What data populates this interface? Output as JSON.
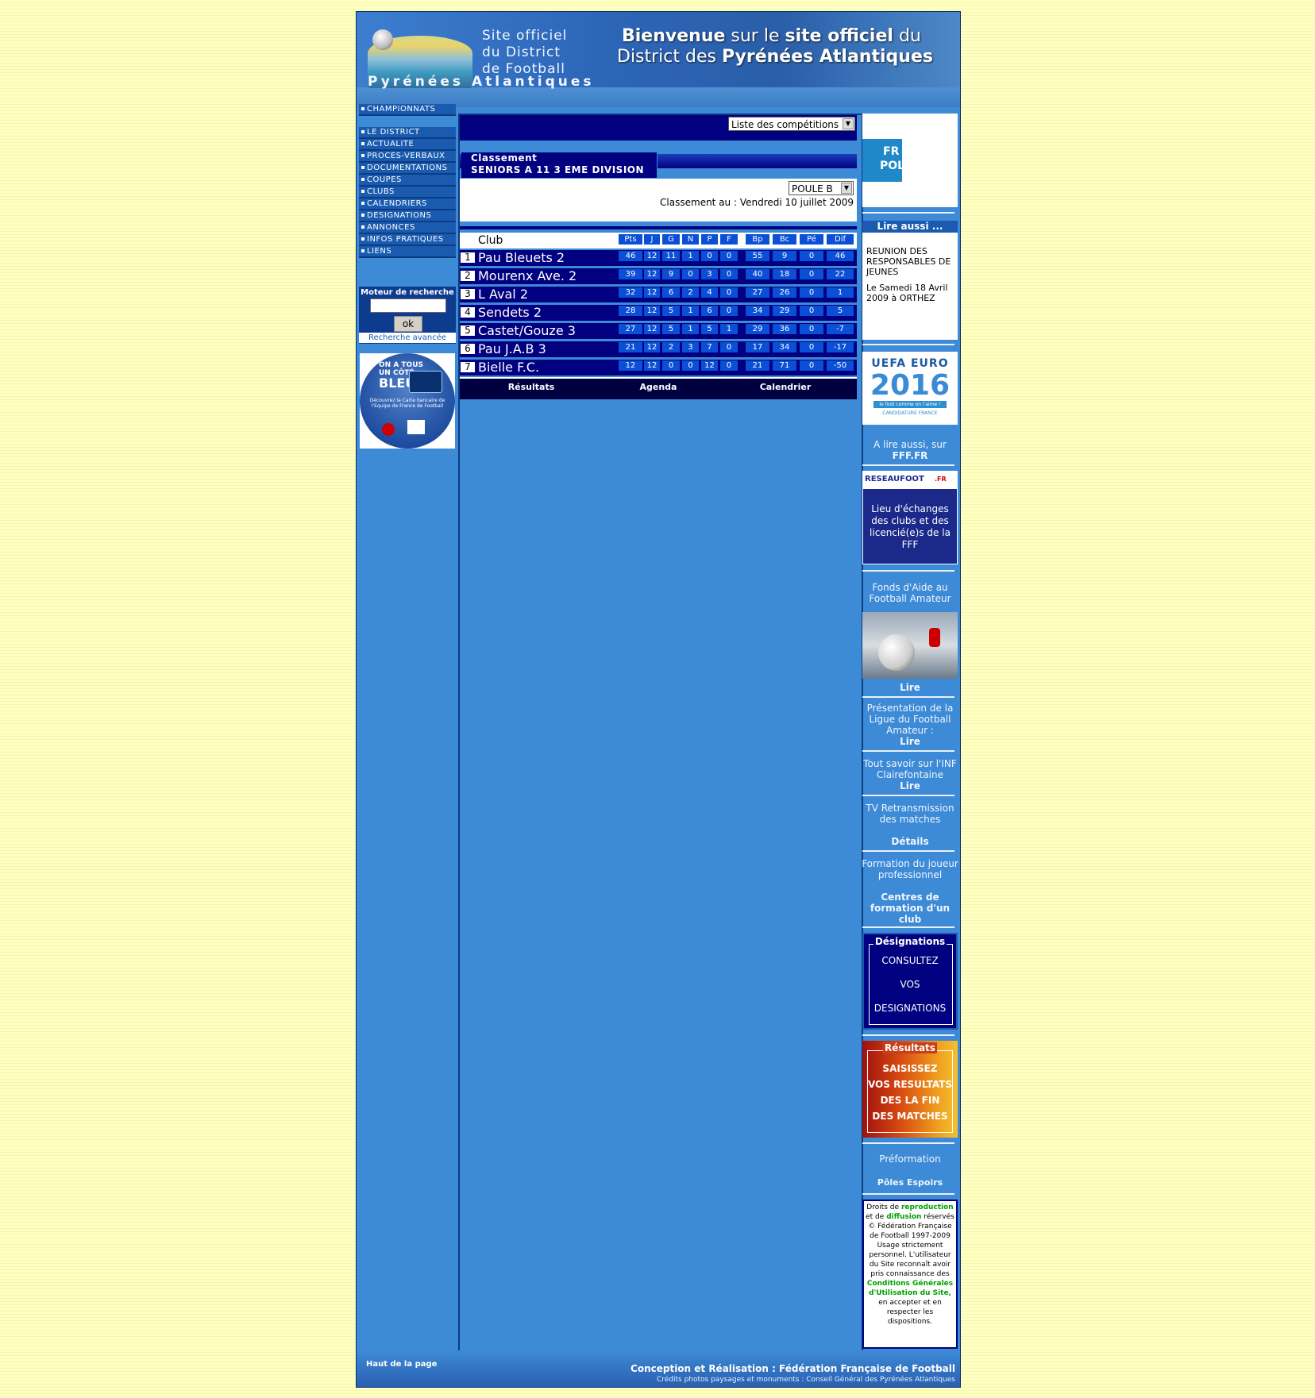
{
  "header": {
    "subtitle_lines": [
      "Site officiel",
      "du District",
      "de Football"
    ],
    "name": "Pyrénées Atlantiques",
    "welcome_line1_prefix": "Bienvenue",
    "welcome_line1_mid": "sur le",
    "welcome_line1_bold": "site officiel",
    "welcome_line1_suffix": "du",
    "welcome_line2_prefix": "District des",
    "welcome_line2_bold": "Pyrénées Atlantiques"
  },
  "nav": {
    "top": "CHAMPIONNATS",
    "items": [
      "LE DISTRICT",
      "ACTUALITE",
      "PROCES-VERBAUX",
      "DOCUMENTATIONS",
      "COUPES",
      "CLUBS",
      "CALENDRIERS",
      "DESIGNATIONS",
      "ANNONCES",
      "INFOS PRATIQUES",
      "LIENS"
    ]
  },
  "search": {
    "title": "Moteur de recherche",
    "value": "",
    "button": "ok",
    "advanced": "Recherche avancée"
  },
  "promo": {
    "line1": "ON A TOUS",
    "line2": "UN CÔTÉ",
    "line3": "BLEU",
    "text": "Découvrez la Carte bancaire de l'Equipe de France de Football"
  },
  "competition": {
    "select": "Liste des compétitions",
    "title_label": "Classement",
    "title_division": "SENIORS A 11 3 EME DIVISION",
    "poule": "POULE B",
    "date_line": "Classement au : Vendredi 10 juillet 2009"
  },
  "table": {
    "club_header": "Club",
    "columns": [
      "Pts",
      "J",
      "G",
      "N",
      "P",
      "F",
      "Bp",
      "Bc",
      "Pé",
      "Dif"
    ],
    "rows": [
      {
        "rank": "1",
        "club": "Pau Bleuets 2",
        "stats": [
          "46",
          "12",
          "11",
          "1",
          "0",
          "0",
          "55",
          "9",
          "0",
          "46"
        ]
      },
      {
        "rank": "2",
        "club": "Mourenx Ave. 2",
        "stats": [
          "39",
          "12",
          "9",
          "0",
          "3",
          "0",
          "40",
          "18",
          "0",
          "22"
        ]
      },
      {
        "rank": "3",
        "club": "L Aval 2",
        "stats": [
          "32",
          "12",
          "6",
          "2",
          "4",
          "0",
          "27",
          "26",
          "0",
          "1"
        ]
      },
      {
        "rank": "4",
        "club": "Sendets 2",
        "stats": [
          "28",
          "12",
          "5",
          "1",
          "6",
          "0",
          "34",
          "29",
          "0",
          "5"
        ]
      },
      {
        "rank": "5",
        "club": "Castet/Gouze 3",
        "stats": [
          "27",
          "12",
          "5",
          "1",
          "5",
          "1",
          "29",
          "36",
          "0",
          "-7"
        ]
      },
      {
        "rank": "6",
        "club": "Pau J.A.B 3",
        "stats": [
          "21",
          "12",
          "2",
          "3",
          "7",
          "0",
          "17",
          "34",
          "0",
          "-17"
        ]
      },
      {
        "rank": "7",
        "club": "Bielle F.C.",
        "stats": [
          "12",
          "12",
          "0",
          "0",
          "12",
          "0",
          "21",
          "71",
          "0",
          "-50"
        ]
      }
    ]
  },
  "tabs": [
    "Résultats",
    "Agenda",
    "Calendrier"
  ],
  "right": {
    "banner_text_1": "FR",
    "banner_text_2": "POL",
    "lire_aussi_title": "Lire aussi ...",
    "lire_aussi_item": "REUNION DES RESPONSABLES DE JEUNES",
    "lire_aussi_date": "Le Samedi 18 Avril 2009 à ORTHEZ",
    "euro_title": "UEFA EURO",
    "euro_year": "2016",
    "euro_tagline": "le foot comme on l'aime !",
    "euro_cand": "CANDIDATURE FRANCE",
    "fff_line1": "A lire aussi, sur",
    "fff_line2": "FFF.FR",
    "reseau_logo": "RESEAUFOOT",
    "reseau_fr": ".FR",
    "reseau_text": "Lieu d'échanges des clubs et des licencié(e)s de la FFF",
    "fonds_line1": "Fonds d'Aide au",
    "fonds_line2": "Football Amateur",
    "fonds_link": "Lire",
    "ligue_text": "Présentation de la Ligue du Football Amateur :",
    "ligue_link": "Lire",
    "inf_text": "Tout savoir sur l'INF Clairefontaine",
    "inf_link": "Lire",
    "tv_text": "TV Retransmission des matches",
    "tv_link": "Détails",
    "formation_text": "Formation du joueur professionnel",
    "formation_link": "Centres de formation d'un club",
    "desig_title": "Désignations",
    "desig_lines": [
      "CONSULTEZ",
      "VOS",
      "DESIGNATIONS"
    ],
    "res_title": "Résultats",
    "res_lines": [
      "SAISISSEZ",
      "VOS RESULTATS",
      "DES LA FIN",
      "DES MATCHES"
    ],
    "preformation": "Préformation",
    "poles": "Pôles Espoirs",
    "rights_1": "Droits de",
    "rights_repro": "reproduction",
    "rights_2": "et de",
    "rights_diff": "diffusion",
    "rights_3": "réservés © Fédération Française de Football 1997-2009 Usage strictement personnel. L'utilisateur du Site reconnaît avoir pris connaissance des",
    "rights_cgu": "Conditions Générales d'Utilisation du Site,",
    "rights_4": "en accepter et en respecter les dispositions."
  },
  "footer": {
    "top_link": "Haut de la page",
    "credit": "Conception et Réalisation : Fédération Française de Football",
    "photos": "Crédits photos paysages et monuments : Conseil Général des Pyrénées Atlantiques"
  },
  "colors": {
    "background": "#ffffc0",
    "frame": "#3d8ad6",
    "navy": "#000080",
    "cell": "#0a4fd6",
    "link_green": "#00a000"
  }
}
